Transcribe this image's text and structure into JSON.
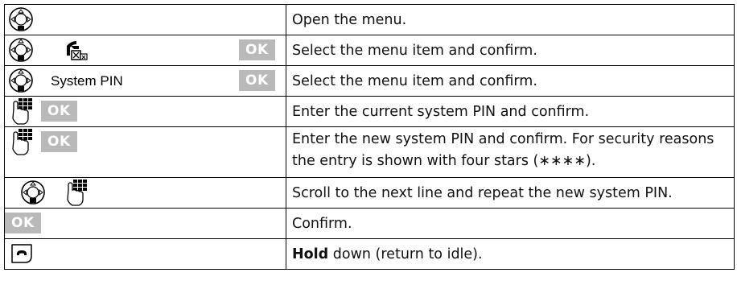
{
  "rows": [
    {
      "keys": [
        "control-key-down-icon"
      ],
      "text": "Open the menu."
    },
    {
      "keys": [
        "control-key-updown-icon",
        "system-settings-icon",
        "ok-key"
      ],
      "ok": "OK",
      "text": "Select the menu item and confirm."
    },
    {
      "keys": [
        "control-key-updown-icon",
        "ok-key"
      ],
      "label": "System PIN",
      "ok": "OK",
      "text": "Select the menu item and confirm."
    },
    {
      "keys": [
        "keypad-icon",
        "ok-key"
      ],
      "ok": "OK",
      "text": "Enter the current system PIN and confirm."
    },
    {
      "keys": [
        "keypad-icon",
        "ok-key"
      ],
      "ok": "OK",
      "text": "Enter the new system PIN and confirm. For security reasons the entry is shown with four stars (∗∗∗∗)."
    },
    {
      "keys": [
        "control-key-updown-icon",
        "keypad-icon"
      ],
      "text": "Scroll to the next line and repeat the new system PIN."
    },
    {
      "keys": [
        "ok-key"
      ],
      "ok": "OK",
      "text": "Confirm."
    },
    {
      "keys": [
        "end-call-key-icon"
      ],
      "bold": "Hold",
      "text_rest": " down (return to idle)."
    }
  ],
  "colors": {
    "ok_key_bg": "#b9b9b9",
    "ok_key_text": "#ffffff",
    "border": "#000000"
  }
}
